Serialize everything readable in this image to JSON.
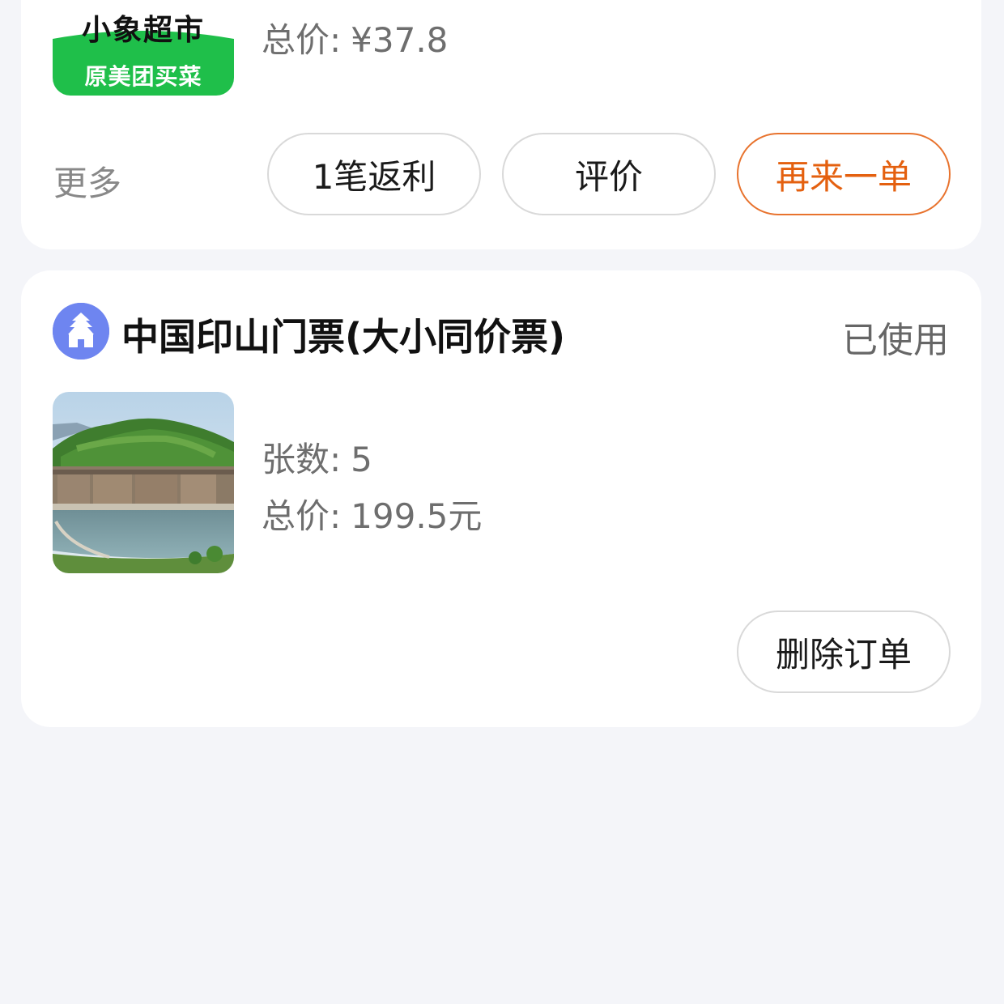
{
  "order1": {
    "logo_line1": "小象超市",
    "logo_line2": "原美团买菜",
    "total_label": "总价:",
    "total_value": "¥37.8",
    "more_label": "更多",
    "buttons": {
      "rebate": "1笔返利",
      "review": "评价",
      "reorder": "再来一单"
    }
  },
  "order2": {
    "title": "中国印山门票(大小同价票)",
    "status": "已使用",
    "icon": "temple-icon",
    "count_label": "张数:",
    "count_value": "5",
    "total_label": "总价:",
    "total_value": "199.5元",
    "buttons": {
      "delete": "删除订单"
    }
  },
  "colors": {
    "accent_orange": "#e4600f",
    "brand_green": "#1fbf4a",
    "icon_blue": "#6e85f0",
    "background": "#f4f5f9"
  }
}
